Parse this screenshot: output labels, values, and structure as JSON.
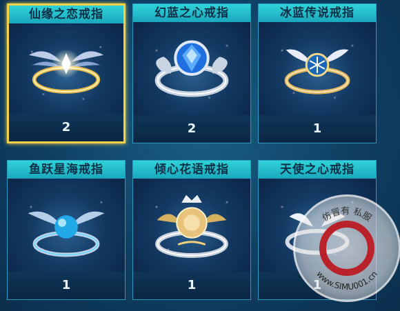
{
  "rings": [
    {
      "name": "仙缘之恋戒指",
      "count": "2",
      "selected": true,
      "metal": "gold"
    },
    {
      "name": "幻蓝之心戒指",
      "count": "2",
      "selected": false,
      "metal": "silver"
    },
    {
      "name": "冰蓝传说戒指",
      "count": "1",
      "selected": false,
      "metal": "gold"
    },
    {
      "name": "鱼跃星海戒指",
      "count": "1",
      "selected": false,
      "metal": "silver"
    },
    {
      "name": "倾心花语戒指",
      "count": "1",
      "selected": false,
      "metal": "gold"
    },
    {
      "name": "天使之心戒指",
      "count": "1",
      "selected": false,
      "metal": "silver"
    }
  ],
  "colors": {
    "title_bar": "#2fd3d8",
    "selected_border": "#f2d047",
    "card_border": "#2a9bc0",
    "watermark_red": "#b9222b"
  },
  "watermark": {
    "site": "www.SIMU001.cn",
    "chars": "仿冒有 私服"
  }
}
